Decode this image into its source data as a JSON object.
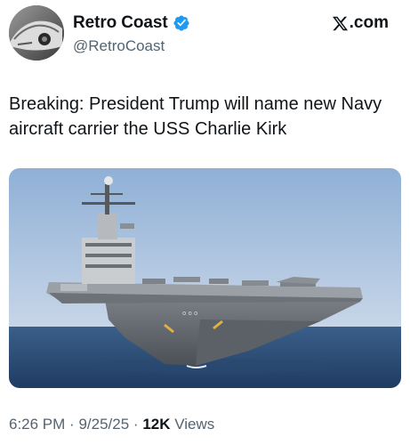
{
  "user": {
    "display_name": "Retro Coast",
    "handle": "@RetroCoast",
    "verified": true,
    "avatar_icon": "car-avatar"
  },
  "brand": {
    "label": ".com",
    "icon": "x-logo-icon"
  },
  "tweet": {
    "text": "Breaking: President Trump will name new Navy aircraft carrier the USS Charlie Kirk"
  },
  "media": {
    "alt": "aircraft carrier photo"
  },
  "meta": {
    "time": "6:26 PM",
    "separator": "·",
    "date": "9/25/25",
    "views_count": "12K",
    "views_label": "Views"
  },
  "colors": {
    "verified": "#1d9bf0",
    "text": "#0f1419",
    "muted": "#536471"
  }
}
